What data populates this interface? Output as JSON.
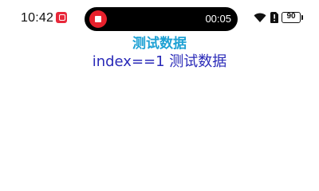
{
  "status_bar": {
    "time": "10:42",
    "recording_timer": "00:05",
    "battery_level": "90",
    "icons": [
      "app-badge-icon",
      "record-stop-icon",
      "wifi-icon",
      "sim-alert-icon",
      "battery-icon"
    ]
  },
  "content": {
    "title": "测试数据",
    "index_line": "index==1 测试数据"
  },
  "colors": {
    "title": "#1ea1d4",
    "index_line": "#2a2ab8",
    "record_red": "#e8212c",
    "badge_red": "#e8283a"
  }
}
